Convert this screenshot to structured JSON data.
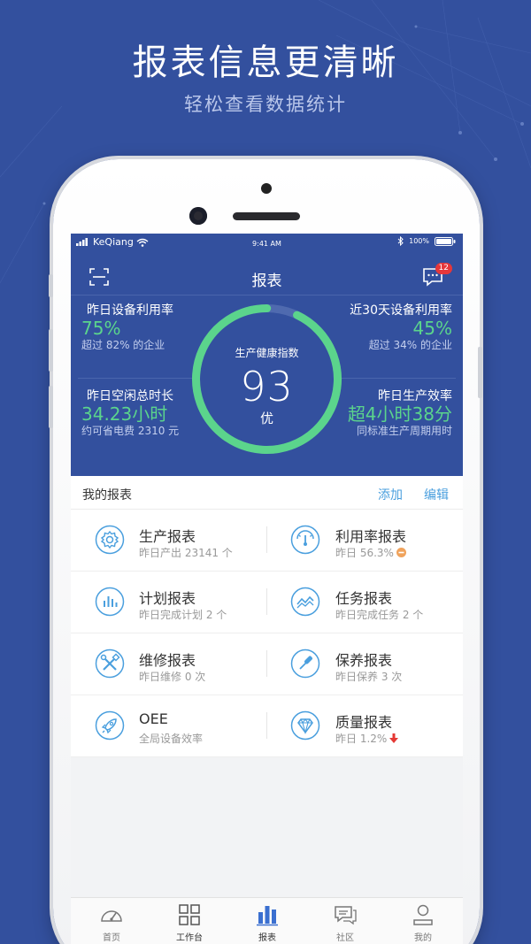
{
  "promo": {
    "title": "报表信息更清晰",
    "subtitle": "轻松查看数据统计"
  },
  "status_bar": {
    "carrier": "KeQiang",
    "time": "9:41 AM",
    "battery": "100%"
  },
  "nav": {
    "title": "报表",
    "message_badge": "12",
    "left_icon": "scan-icon",
    "right_icon": "message-icon"
  },
  "dashboard": {
    "gauge": {
      "label": "生产健康指数",
      "score": "93",
      "grade": "优",
      "level": 0.93,
      "color": "#5bd48c"
    },
    "stats": [
      {
        "label": "昨日设备利用率",
        "value": "75%",
        "desc": "超过 82% 的企业"
      },
      {
        "label": "近30天设备利用率",
        "value": "45%",
        "desc": "超过 34% 的企业"
      },
      {
        "label": "昨日空闲总时长",
        "value": "34.23小时",
        "desc": "约可省电费 2310 元"
      },
      {
        "label": "昨日生产效率",
        "value": "超4小时38分",
        "desc": "同标准生产周期用时"
      }
    ]
  },
  "reports_section": {
    "title": "我的报表",
    "add_label": "添加",
    "edit_label": "编辑",
    "items": [
      {
        "name": "生产报表",
        "sub": "昨日产出 23141 个",
        "icon": "gear-icon"
      },
      {
        "name": "利用率报表",
        "sub": "昨日 56.3%",
        "icon": "speedometer-icon",
        "indicator": "minus-badge-icon"
      },
      {
        "name": "计划报表",
        "sub": "昨日完成计划 2 个",
        "icon": "bar-chart-icon"
      },
      {
        "name": "任务报表",
        "sub": "昨日完成任务 2 个",
        "icon": "trend-chart-icon"
      },
      {
        "name": "维修报表",
        "sub": "昨日维修 0 次",
        "icon": "tools-icon"
      },
      {
        "name": "保养报表",
        "sub": "昨日保养 3 次",
        "icon": "screwdriver-icon"
      },
      {
        "name": "OEE",
        "sub": "全局设备效率",
        "icon": "rocket-icon"
      },
      {
        "name": "质量报表",
        "sub": "昨日 1.2%",
        "icon": "diamond-icon",
        "indicator": "down-arrow-icon"
      }
    ]
  },
  "tabbar": [
    {
      "label": "首页",
      "icon": "dashboard-icon"
    },
    {
      "label": "工作台",
      "icon": "grid-icon"
    },
    {
      "label": "报表",
      "icon": "report-bars-icon",
      "active": true
    },
    {
      "label": "社区",
      "icon": "chat-icon"
    },
    {
      "label": "我的",
      "icon": "user-icon"
    }
  ],
  "colors": {
    "brand_blue": "#33509e",
    "accent_green": "#5bd48c",
    "link_blue": "#4a9fde",
    "icon_blue": "#4a9fde",
    "active_tab": "#3a6fd0",
    "badge_red": "#e5373a",
    "minus_orange": "#f0a35c",
    "down_red": "#e53935"
  }
}
